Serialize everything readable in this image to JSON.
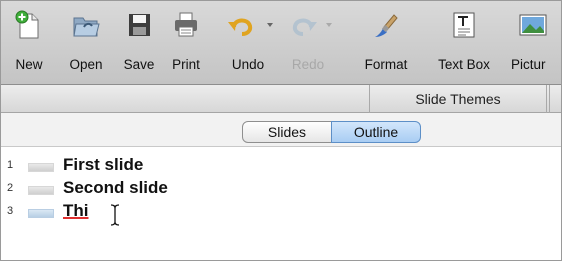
{
  "toolbar": {
    "buttons": [
      {
        "id": "new",
        "label": "New",
        "icon": "new-document-icon",
        "enabled": true
      },
      {
        "id": "open",
        "label": "Open",
        "icon": "folder-open-icon",
        "enabled": true
      },
      {
        "id": "save",
        "label": "Save",
        "icon": "floppy-disk-icon",
        "enabled": true
      },
      {
        "id": "print",
        "label": "Print",
        "icon": "printer-icon",
        "enabled": true
      },
      {
        "id": "undo",
        "label": "Undo",
        "icon": "undo-arrow-icon",
        "enabled": true
      },
      {
        "id": "redo",
        "label": "Redo",
        "icon": "redo-arrow-icon",
        "enabled": false
      },
      {
        "id": "format",
        "label": "Format",
        "icon": "paintbrush-icon",
        "enabled": true
      },
      {
        "id": "textbox",
        "label": "Text Box",
        "icon": "text-box-icon",
        "enabled": true
      },
      {
        "id": "picture",
        "label": "Pictur",
        "icon": "picture-icon",
        "enabled": true
      }
    ]
  },
  "gallery": {
    "active_tab": "Slide Themes"
  },
  "view_switcher": {
    "slides_label": "Slides",
    "outline_label": "Outline",
    "selected": "Outline"
  },
  "outline": {
    "rows": [
      {
        "number": "1",
        "text": "First slide"
      },
      {
        "number": "2",
        "text": "Second slide"
      },
      {
        "number": "3",
        "text": "Thi"
      }
    ]
  },
  "colors": {
    "selected_segment": "#a9cdf3",
    "spellcheck_underline": "#e03030"
  }
}
